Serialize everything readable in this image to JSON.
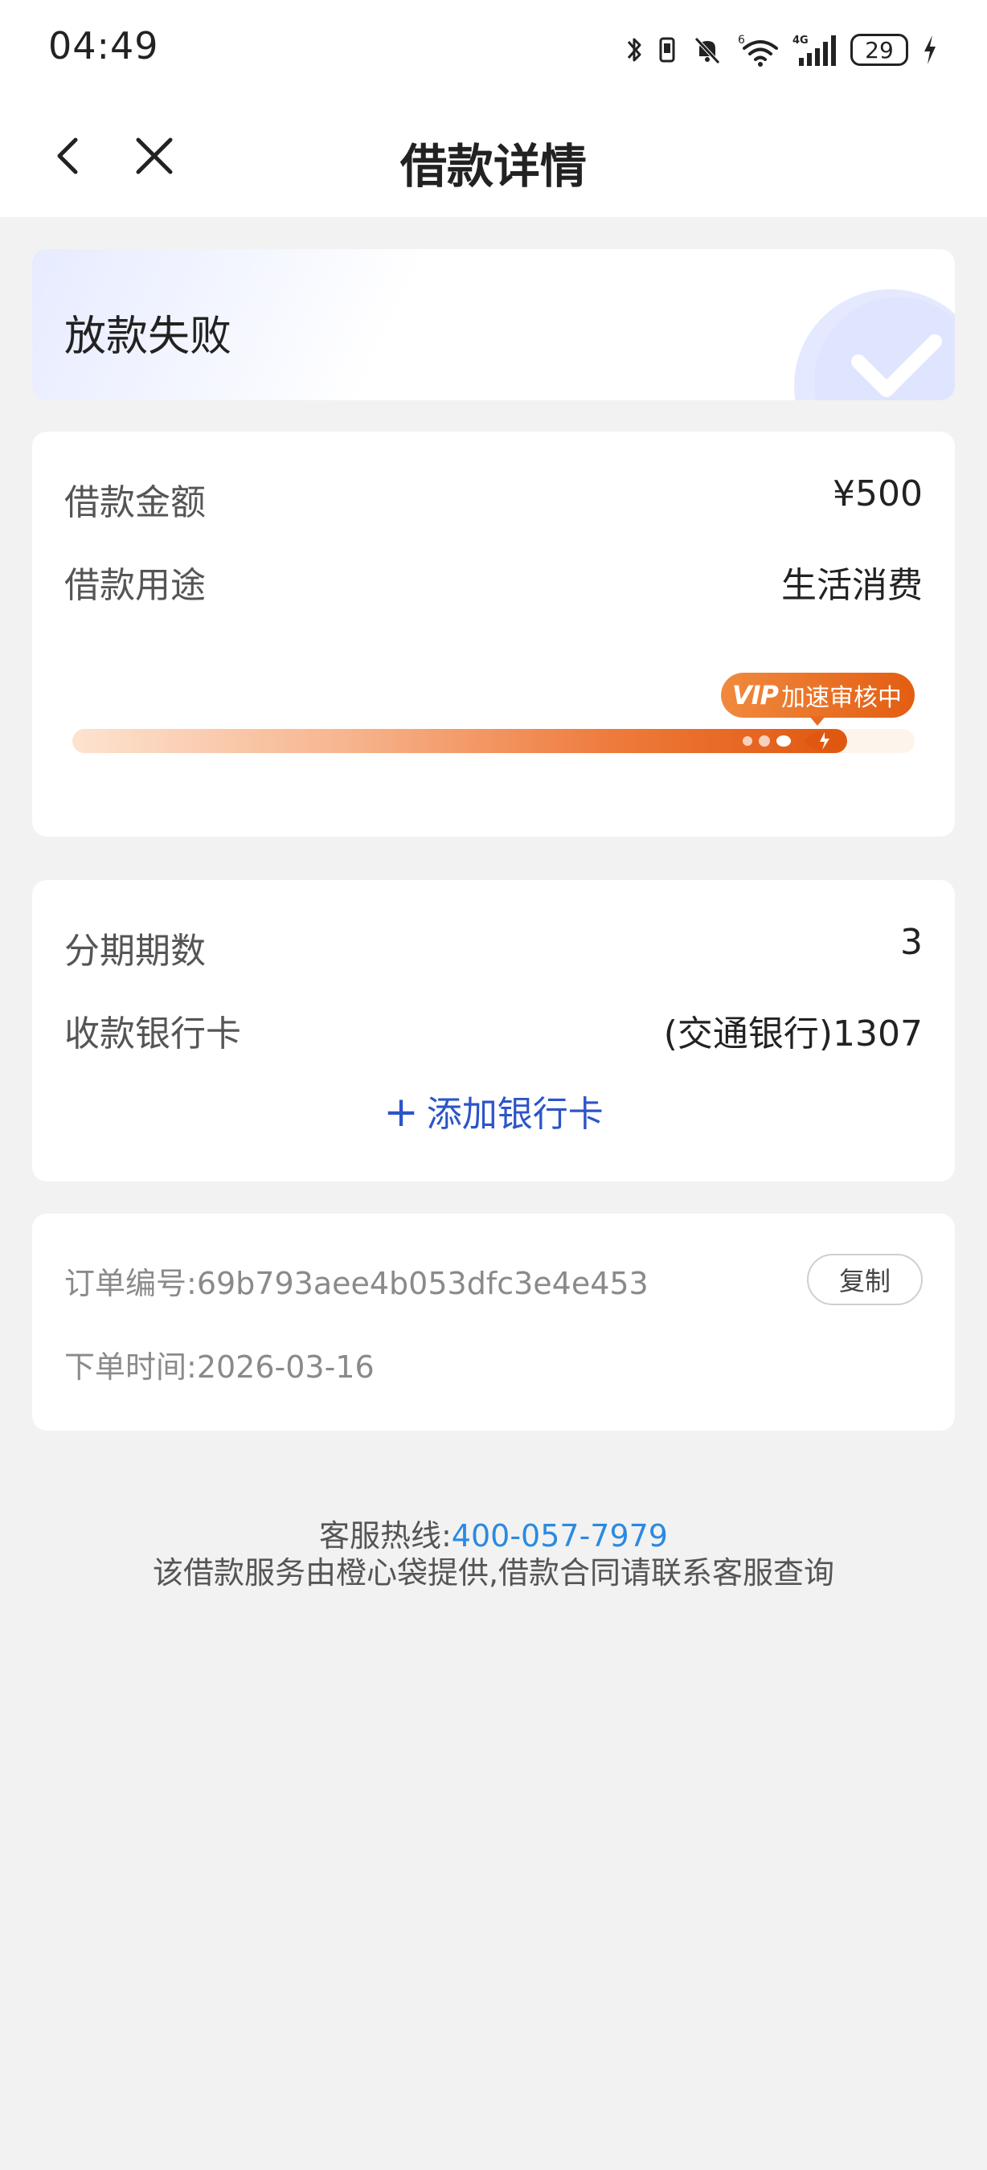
{
  "status_bar": {
    "time": "04:49",
    "battery": "29",
    "signal_label": "4G",
    "wifi_label": "6"
  },
  "nav": {
    "title": "借款详情"
  },
  "loan_status": {
    "title": "放款失败"
  },
  "loan_info": {
    "amount_label": "借款金额",
    "amount_value": "¥500",
    "purpose_label": "借款用途",
    "purpose_value": "生活消费",
    "progress_badge_tag": "VIP",
    "progress_badge_text": "加速审核中",
    "progress_fraction": 0.92
  },
  "bank_info": {
    "installments_label": "分期期数",
    "installments_value": "3",
    "card_label": "收款银行卡",
    "card_value": "(交通银行)1307",
    "add_card_label": "添加银行卡"
  },
  "order": {
    "number_label": "订单编号:",
    "number_value": "69b793aee4b053dfc3e4e453",
    "copy_label": "复制",
    "time_label": "下单时间:",
    "time_value": "2026-03-16"
  },
  "footer": {
    "hotline_label": "客服热线:",
    "hotline_number": "400-057-7979",
    "notice": "该借款服务由橙心袋提供,借款合同请联系客服查询"
  },
  "colors": {
    "accent_blue": "#2d55c8",
    "hotline_blue": "#2a8ae0",
    "progress_orange": "#e0580f",
    "background": "#f2f2f2"
  }
}
